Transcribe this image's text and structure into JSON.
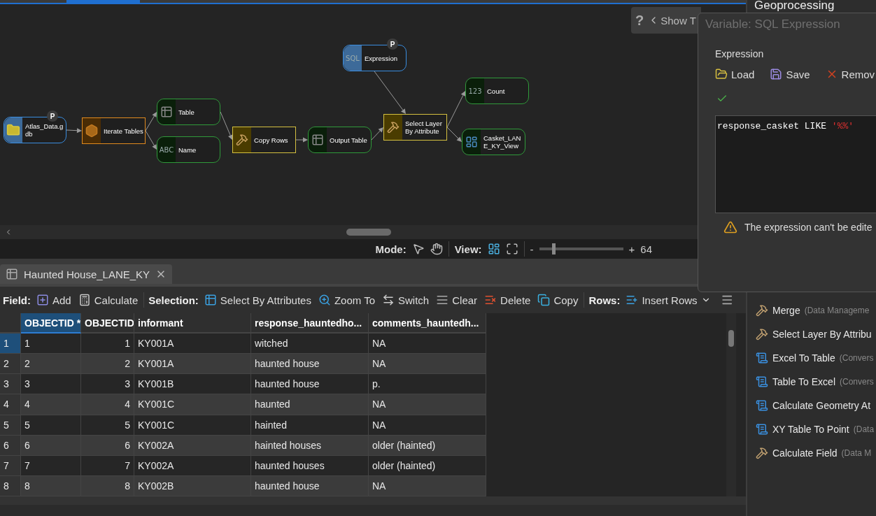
{
  "model": {
    "nodes": [
      {
        "kind": "variable",
        "label": "Expression",
        "badge": "P",
        "icon_text": "SQL"
      },
      {
        "kind": "derived",
        "label": "Count",
        "icon_text": "123"
      },
      {
        "kind": "derived",
        "label": "Table"
      },
      {
        "kind": "variable",
        "label": "Atlas_Data.g db",
        "badge": "P"
      },
      {
        "kind": "iterator",
        "label": "Iterate Tables"
      },
      {
        "kind": "tool",
        "label": "Copy Rows"
      },
      {
        "kind": "derived",
        "label": "Output Table"
      },
      {
        "kind": "tool",
        "label": "Select Layer By Attribute"
      },
      {
        "kind": "derived",
        "label": "Casket_LAN E_KY_View"
      },
      {
        "kind": "derived",
        "label": "Name",
        "icon_text": "ABC"
      }
    ],
    "help_label": "?",
    "show_button": "Show T"
  },
  "status_bar": {
    "mode_label": "Mode:",
    "view_label": "View:",
    "zoom": {
      "minus": "-",
      "plus": "+",
      "level": 0.15,
      "reading": "64"
    }
  },
  "table_tab": {
    "title": "Haunted House_LANE_KY"
  },
  "toolbar": {
    "groups": [
      {
        "label": "Field:",
        "buttons": [
          "Add",
          "Calculate"
        ]
      },
      {
        "label": "Selection:",
        "buttons": [
          "Select By Attributes",
          "Zoom To",
          "Switch",
          "Clear",
          "Delete",
          "Copy"
        ]
      },
      {
        "label": "Rows:",
        "buttons": [
          "Insert Rows"
        ]
      }
    ]
  },
  "table": {
    "columns": [
      {
        "label": "OBJECTID *",
        "selected": true
      },
      {
        "label": "OBJECTID",
        "selected": false
      },
      {
        "label": "informant",
        "selected": false
      },
      {
        "label": "response_hauntedho...",
        "selected": false
      },
      {
        "label": "comments_hauntedh...",
        "selected": false
      }
    ],
    "rows": [
      {
        "number": "1",
        "selected": true,
        "cells": [
          "1",
          "1",
          "KY001A",
          "witched",
          "NA"
        ]
      },
      {
        "number": "2",
        "selected": false,
        "cells": [
          "2",
          "2",
          "KY001A",
          "haunted house",
          "NA"
        ]
      },
      {
        "number": "3",
        "selected": false,
        "cells": [
          "3",
          "3",
          "KY001B",
          "haunted house",
          "p."
        ]
      },
      {
        "number": "4",
        "selected": false,
        "cells": [
          "4",
          "4",
          "KY001C",
          "haunted",
          "NA"
        ]
      },
      {
        "number": "5",
        "selected": false,
        "cells": [
          "5",
          "5",
          "KY001C",
          "hainted",
          "NA"
        ]
      },
      {
        "number": "6",
        "selected": false,
        "cells": [
          "6",
          "6",
          "KY002A",
          "hainted houses",
          "older (hainted)"
        ]
      },
      {
        "number": "7",
        "selected": false,
        "cells": [
          "7",
          "7",
          "KY002A",
          "haunted houses",
          "older (hainted)"
        ]
      },
      {
        "number": "8",
        "selected": false,
        "cells": [
          "8",
          "8",
          "KY002B",
          "haunted house",
          "NA"
        ]
      }
    ]
  },
  "geoprocessing": {
    "title": "Geoprocessing",
    "items": [
      {
        "kind": "tool",
        "name": "Merge",
        "category": "(Data Manageme"
      },
      {
        "kind": "tool",
        "name": "Select Layer By Attribu"
      },
      {
        "kind": "script",
        "name": "Excel To Table",
        "category": "(Convers"
      },
      {
        "kind": "script",
        "name": "Table To Excel",
        "category": "(Convers"
      },
      {
        "kind": "script",
        "name": "Calculate Geometry At"
      },
      {
        "kind": "script",
        "name": "XY Table To Point",
        "category": "(Data"
      },
      {
        "kind": "tool",
        "name": "Calculate Field",
        "category": "(Data M"
      }
    ]
  },
  "dialog": {
    "title": "Variable: SQL Expression",
    "section": "Expression",
    "buttons": [
      "Load",
      "Save",
      "Remov"
    ],
    "valid": true,
    "code": {
      "field_part": "response_casket LIKE",
      "string_part": "'%%'"
    },
    "warning": "The expression can't be edite"
  }
}
